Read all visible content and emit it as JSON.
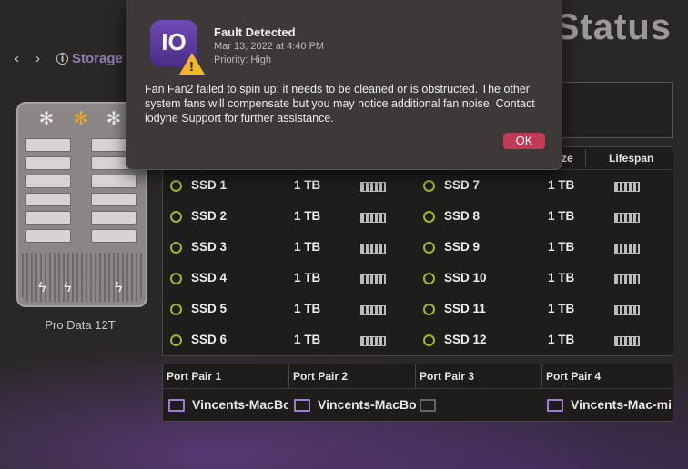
{
  "header": {
    "title": "Status",
    "breadcrumb": "Storage"
  },
  "nav": {
    "back": "‹",
    "forward": "›"
  },
  "device": {
    "label": "Pro Data 12T"
  },
  "ssd_table": {
    "headers": {
      "size_partial": "ze",
      "lifespan": "Lifespan"
    },
    "left": [
      {
        "name": "SSD 1",
        "size": "1 TB"
      },
      {
        "name": "SSD 2",
        "size": "1 TB"
      },
      {
        "name": "SSD 3",
        "size": "1 TB"
      },
      {
        "name": "SSD 4",
        "size": "1 TB"
      },
      {
        "name": "SSD 5",
        "size": "1 TB"
      },
      {
        "name": "SSD 6",
        "size": "1 TB"
      }
    ],
    "right": [
      {
        "name": "SSD 7",
        "size": "1 TB"
      },
      {
        "name": "SSD 8",
        "size": "1 TB"
      },
      {
        "name": "SSD 9",
        "size": "1 TB"
      },
      {
        "name": "SSD 10",
        "size": "1 TB"
      },
      {
        "name": "SSD 11",
        "size": "1 TB"
      },
      {
        "name": "SSD 12",
        "size": "1 TB"
      }
    ]
  },
  "port_table": {
    "headers": [
      "Port Pair 1",
      "Port Pair 2",
      "Port Pair 3",
      "Port Pair 4"
    ],
    "values": [
      "Vincents-MacBoo",
      "Vincents-MacBoo",
      "",
      "Vincents-Mac-mi"
    ]
  },
  "dialog": {
    "title": "Fault Detected",
    "date": "Mar 13, 2022 at 4:40 PM",
    "priority": "Priority: High",
    "message": "Fan Fan2 failed to spin up: it needs to be cleaned or is obstructed. The other system fans will compensate but you may notice additional fan noise. Contact iodyne Support for further assistance.",
    "ok_label": "OK",
    "app_icon_text": "IO"
  },
  "colors": {
    "accent": "#c13b58",
    "status_ring": "#9fb62c",
    "purple": "#8e7fb0",
    "fan_warning": "#e7a626"
  }
}
